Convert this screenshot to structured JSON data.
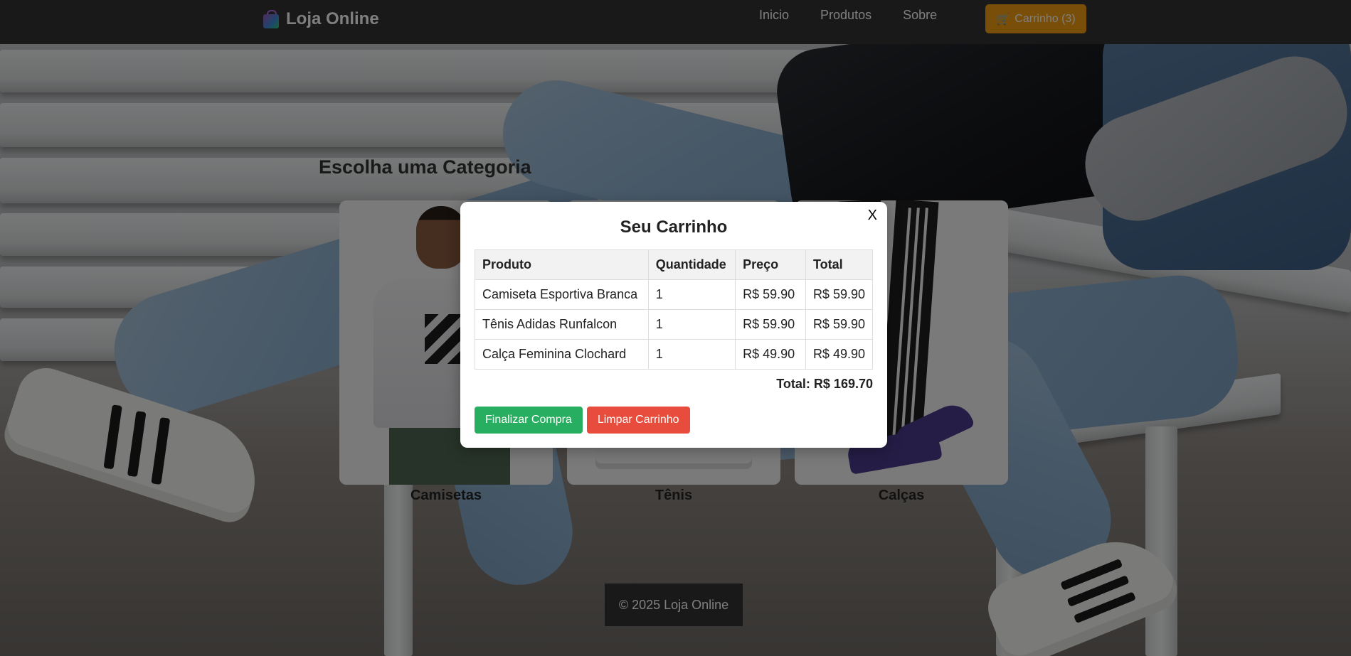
{
  "navbar": {
    "brand_name": "Loja Online",
    "brand_icon": "shopping-bags-icon",
    "links": [
      {
        "label": "Inicio"
      },
      {
        "label": "Produtos"
      },
      {
        "label": "Sobre"
      }
    ],
    "cart_button": {
      "icon": "cart-icon",
      "label": "Carrinho (3)"
    }
  },
  "main": {
    "section_title": "Escolha uma Categoria",
    "categories": [
      {
        "label": "Camisetas"
      },
      {
        "label": "Tênis"
      },
      {
        "label": "Calças"
      }
    ]
  },
  "footer": {
    "text": "© 2025 Loja Online"
  },
  "cart_modal": {
    "close_label": "X",
    "title": "Seu Carrinho",
    "columns": [
      "Produto",
      "Quantidade",
      "Preço",
      "Total"
    ],
    "rows": [
      [
        "Camiseta Esportiva Branca",
        "1",
        "R$ 59.90",
        "R$ 59.90"
      ],
      [
        "Tênis Adidas Runfalcon",
        "1",
        "R$ 59.90",
        "R$ 59.90"
      ],
      [
        "Calça Feminina Clochard",
        "1",
        "R$ 49.90",
        "R$ 49.90"
      ]
    ],
    "total_text": "Total: R$ 169.70",
    "finish_label": "Finalizar Compra",
    "clear_label": "Limpar Carrinho"
  },
  "colors": {
    "navbar_bg": "#333333",
    "cart_button": "#f39c12",
    "finish_button": "#27ae60",
    "clear_button": "#e74c3c",
    "overlay": "rgba(0,0,0,0.5)"
  }
}
